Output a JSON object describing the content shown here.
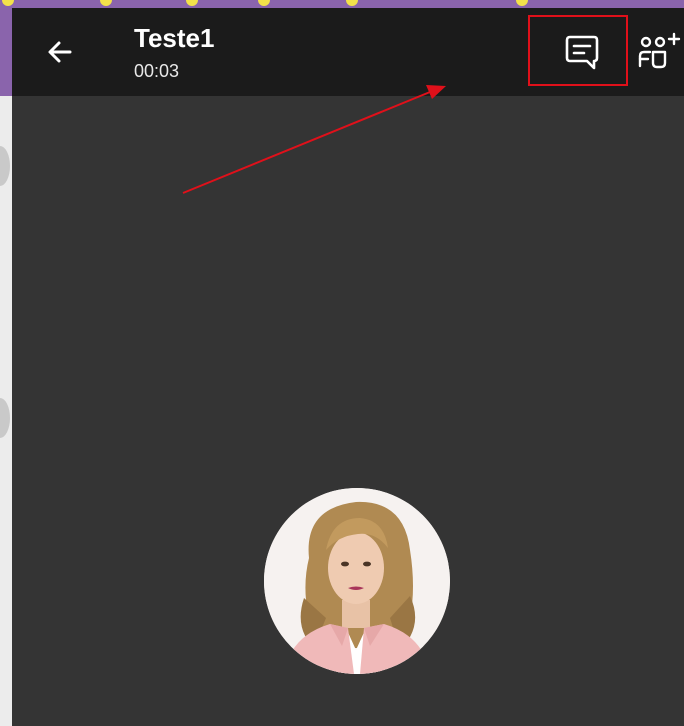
{
  "call": {
    "title": "Teste1",
    "timer": "00:03"
  },
  "icons": {
    "back": "arrow-left-icon",
    "chat": "chat-icon",
    "add_participant": "add-participant-icon"
  },
  "colors": {
    "app_bar": "#1b1b1b",
    "call_background": "#343434",
    "annotation": "#e0101a",
    "outer_accent": "#8a64ac"
  }
}
